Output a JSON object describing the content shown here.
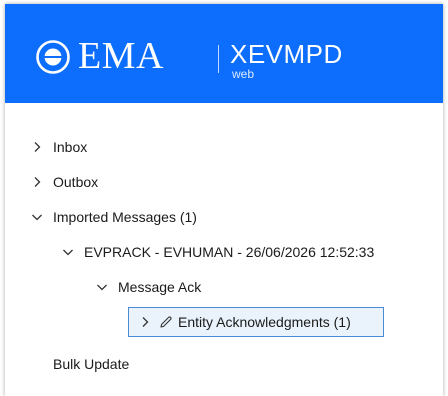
{
  "header": {
    "brand": "EMA",
    "product": "XEVMPD",
    "product_sub": "web",
    "background_color": "#0d6efd"
  },
  "tree": {
    "items": [
      {
        "label": "Inbox",
        "expanded": false,
        "icon": "chevron-right-icon"
      },
      {
        "label": "Outbox",
        "expanded": false,
        "icon": "chevron-right-icon"
      },
      {
        "label": "Imported Messages (1)",
        "expanded": true,
        "icon": "chevron-down-icon"
      },
      {
        "label": "EVPRACK - EVHUMAN - 26/06/2026 12:52:33",
        "expanded": true,
        "icon": "chevron-down-icon"
      },
      {
        "label": "Message Ack",
        "expanded": true,
        "icon": "chevron-down-icon"
      },
      {
        "label": "Entity Acknowledgments (1)",
        "expanded": false,
        "selected": true,
        "icon": "chevron-right-icon",
        "extra_icon": "pencil-icon"
      },
      {
        "label": "Bulk Update"
      }
    ]
  }
}
